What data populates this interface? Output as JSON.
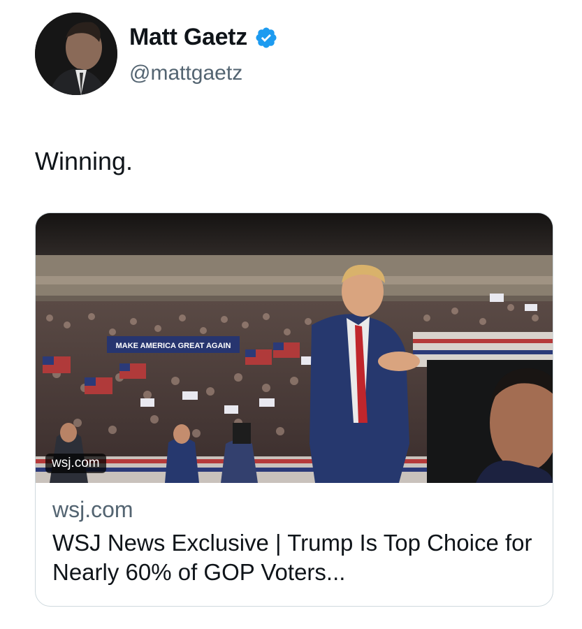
{
  "tweet": {
    "author": {
      "display_name": "Matt Gaetz",
      "handle": "@mattgaetz",
      "verified": true,
      "verified_color": "#1d9bf0",
      "avatar_icon": "profile-photo"
    },
    "text": "Winning."
  },
  "link_card": {
    "image_domain_badge": "wsj.com",
    "image_banner_text": "MAKE AMERICA GREAT AGAIN",
    "domain": "wsj.com",
    "title": "WSJ News Exclusive | Trump Is Top Choice for Nearly 60% of GOP Voters..."
  }
}
